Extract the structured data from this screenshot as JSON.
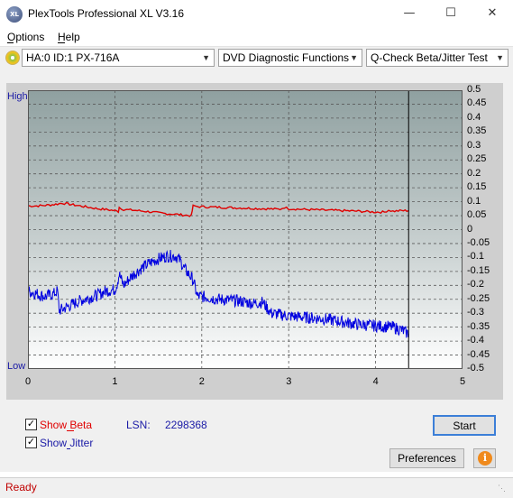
{
  "window": {
    "title": "PlexTools Professional XL V3.16",
    "icon_text": "XL"
  },
  "menu": [
    {
      "label": "Options"
    },
    {
      "label": "Help"
    }
  ],
  "toolbar": {
    "drive": "HA:0 ID:1  PX-716A",
    "function": "DVD Diagnostic Functions",
    "test": "Q-Check Beta/Jitter Test"
  },
  "chart_data": {
    "type": "line",
    "left_axis_labels": {
      "top": "High",
      "bottom": "Low"
    },
    "xlim": [
      0,
      5
    ],
    "ylim": [
      -0.5,
      0.5
    ],
    "x_ticks": [
      "0",
      "1",
      "2",
      "3",
      "4",
      "5"
    ],
    "y_ticks": [
      "0.5",
      "0.45",
      "0.4",
      "0.35",
      "0.3",
      "0.25",
      "0.2",
      "0.15",
      "0.1",
      "0.05",
      "0",
      "-0.05",
      "-0.1",
      "-0.15",
      "-0.2",
      "-0.25",
      "-0.3",
      "-0.35",
      "-0.4",
      "-0.45",
      "-0.5"
    ],
    "grid": true,
    "cursor_x": 4.38,
    "series": [
      {
        "name": "Beta",
        "color": "#e00000",
        "x": [
          0,
          0.1,
          0.2,
          0.3,
          0.4,
          0.5,
          0.6,
          0.7,
          0.8,
          0.9,
          1.0,
          1.04,
          1.05,
          1.1,
          1.2,
          1.3,
          1.4,
          1.5,
          1.6,
          1.7,
          1.8,
          1.88,
          1.9,
          1.95,
          2.0,
          2.2,
          2.4,
          2.6,
          2.8,
          2.9,
          2.95,
          3.0,
          3.2,
          3.4,
          3.6,
          3.8,
          4.0,
          4.1,
          4.15,
          4.2,
          4.3,
          4.38
        ],
        "values": [
          0.085,
          0.085,
          0.087,
          0.09,
          0.095,
          0.09,
          0.085,
          0.08,
          0.075,
          0.072,
          0.068,
          0.065,
          0.08,
          0.072,
          0.07,
          0.067,
          0.064,
          0.06,
          0.057,
          0.055,
          0.052,
          0.05,
          0.085,
          0.083,
          0.082,
          0.08,
          0.078,
          0.076,
          0.074,
          0.073,
          0.08,
          0.075,
          0.072,
          0.07,
          0.068,
          0.066,
          0.063,
          0.063,
          0.07,
          0.066,
          0.068,
          0.068
        ]
      },
      {
        "name": "Jitter",
        "color": "#0000e0",
        "x": [
          0,
          0.1,
          0.2,
          0.3,
          0.34,
          0.36,
          0.4,
          0.5,
          0.6,
          0.7,
          0.8,
          0.9,
          1.0,
          1.02,
          1.05,
          1.1,
          1.2,
          1.3,
          1.4,
          1.5,
          1.6,
          1.7,
          1.75,
          1.8,
          1.85,
          1.9,
          1.95,
          2.0,
          2.2,
          2.4,
          2.6,
          2.7,
          2.8,
          2.9,
          3.0,
          3.2,
          3.4,
          3.6,
          3.8,
          4.0,
          4.2,
          4.3,
          4.38
        ],
        "values": [
          -0.22,
          -0.23,
          -0.24,
          -0.23,
          -0.22,
          -0.29,
          -0.285,
          -0.27,
          -0.255,
          -0.245,
          -0.235,
          -0.22,
          -0.215,
          -0.2,
          -0.16,
          -0.2,
          -0.165,
          -0.14,
          -0.12,
          -0.105,
          -0.095,
          -0.095,
          -0.11,
          -0.14,
          -0.16,
          -0.18,
          -0.24,
          -0.24,
          -0.25,
          -0.255,
          -0.265,
          -0.26,
          -0.3,
          -0.305,
          -0.31,
          -0.315,
          -0.32,
          -0.33,
          -0.34,
          -0.345,
          -0.35,
          -0.36,
          -0.375
        ]
      }
    ]
  },
  "controls": {
    "show_beta": {
      "label": "Show Beta",
      "checked": true
    },
    "show_jitter": {
      "label": "Show Jitter",
      "checked": true
    },
    "lsn_label": "LSN:",
    "lsn_value": "2298368",
    "start_label": "Start",
    "preferences_label": "Preferences",
    "info_icon": "i"
  },
  "status": {
    "text": "Ready"
  },
  "colors": {
    "beta": "#e00000",
    "jitter": "#0000e0",
    "axis_label": "#1a1aa6",
    "status_text": "#c00000"
  }
}
